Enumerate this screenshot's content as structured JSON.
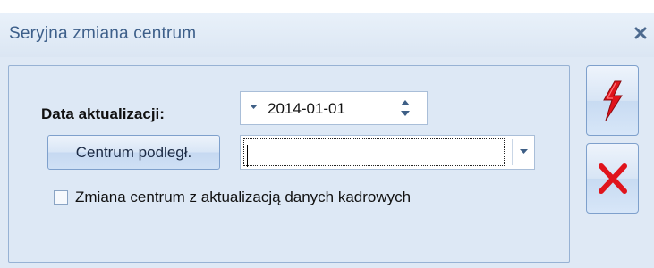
{
  "window": {
    "title": "Seryjna zmiana centrum",
    "close_icon": "close-icon"
  },
  "form": {
    "date_label": "Data aktualizacji:",
    "date_value": "2014-01-01",
    "centrum_button_label": "Centrum podległ.",
    "centrum_value": "",
    "checkbox_label": "Zmiana centrum z aktualizacją danych kadrowych",
    "checkbox_checked": false
  },
  "actions": {
    "run_icon": "lightning-icon",
    "cancel_icon": "cancel-x-icon"
  },
  "colors": {
    "title_text": "#3d5f8a",
    "window_bg": "#dfe9f5",
    "accent_red": "#e0141c"
  }
}
